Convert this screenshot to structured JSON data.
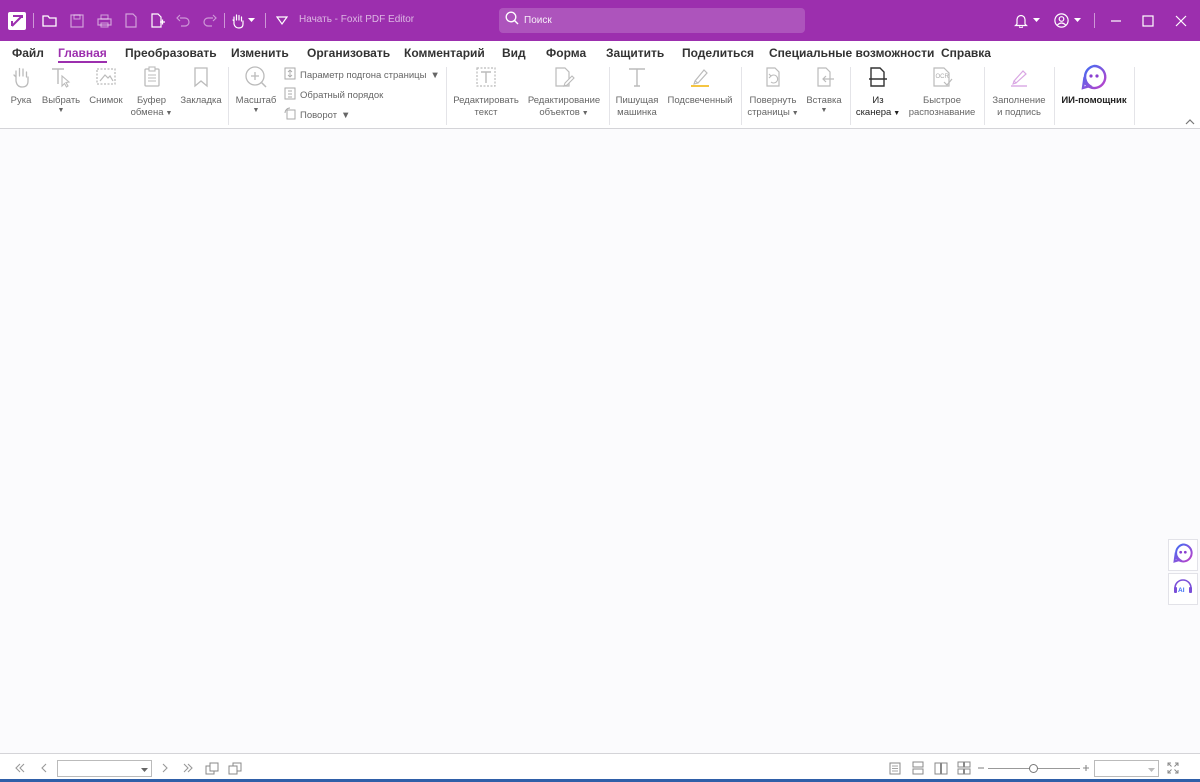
{
  "titlebar": {
    "title": "Начать - Foxit PDF Editor",
    "search_placeholder": "Поиск",
    "icons": [
      "app-logo-icon",
      "open-folder-icon",
      "save-icon",
      "print-icon",
      "pdf-create-icon",
      "new-page-icon",
      "undo-icon",
      "redo-icon",
      "hand-tool-icon",
      "customize-toolbar-icon",
      "bell-icon",
      "account-icon",
      "minimize-icon",
      "maximize-icon",
      "close-icon"
    ]
  },
  "menu": {
    "tabs": [
      "Файл",
      "Главная",
      "Преобразовать",
      "Изменить",
      "Организовать",
      "Комментарий",
      "Вид",
      "Форма",
      "Защитить",
      "Поделиться",
      "Специальные возможности",
      "Справка"
    ],
    "active_tab": "Главная"
  },
  "ribbon": {
    "hand": "Рука",
    "select": "Выбрать",
    "snapshot": "Снимок",
    "clipboard_1": "Буфер",
    "clipboard_2": "обмена",
    "bookmark": "Закладка",
    "zoom": "Масштаб",
    "fit_page": "Параметр подгона страницы",
    "reverse_order": "Обратный порядок",
    "rotate": "Поворот",
    "edit_text_1": "Редактировать",
    "edit_text_2": "текст",
    "edit_object_1": "Редактирование",
    "edit_object_2": "объектов",
    "typewriter_1": "Пишущая",
    "typewriter_2": "машинка",
    "highlight": "Подсвеченный",
    "rotate_pages_1": "Повернуть",
    "rotate_pages_2": "страницы",
    "insert": "Вставка",
    "scanner_1": "Из",
    "scanner_2": "сканера",
    "ocr_1": "Быстрое",
    "ocr_2": "распознавание",
    "fill_sign_1": "Заполнение",
    "fill_sign_2": "и подпись",
    "ai_assistant": "ИИ-помощник",
    "ocr_badge": "OCR"
  },
  "side": {
    "ai_badge": "AI"
  },
  "statusbar": {
    "page_value": "",
    "zoom_value": ""
  },
  "colors": {
    "brand": "#9c2fae",
    "taskbar": "#2f5fa8"
  }
}
